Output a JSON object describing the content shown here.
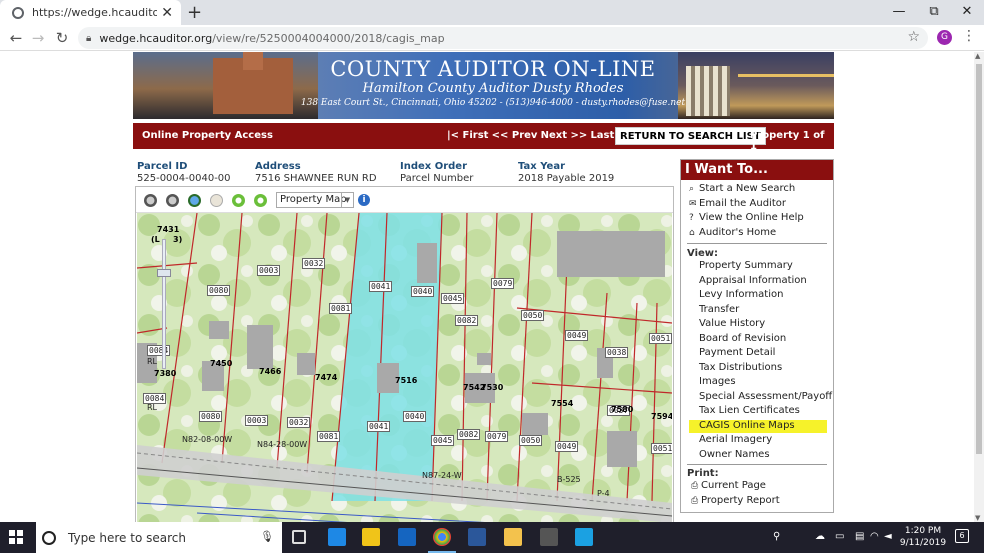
{
  "browser": {
    "tab_title": "https://wedge.hcauditor.org/vie",
    "close_glyph": "✕",
    "new_tab_glyph": "+",
    "window_controls": [
      "—",
      "⧉",
      "✕"
    ],
    "url_host": "wedge.hcauditor.org",
    "url_path": "/view/re/5250004004000/2018/cagis_map",
    "profile_initial": "G"
  },
  "banner": {
    "title": "COUNTY AUDITOR ON-LINE",
    "subtitle": "Hamilton County Auditor Dusty Rhodes",
    "address": "138 East Court St., Cincinnati, Ohio 45202 - (513)946-4000 - dusty.rhodes@fuse.net"
  },
  "redbar": {
    "section": "Online Property Access",
    "first": "|< First",
    "prev": "<< Prev",
    "next": "Next >>",
    "last": "Last >|",
    "return_button": "RETURN TO SEARCH LIST",
    "property_of": "Property 1 of 1"
  },
  "parcel": {
    "id_label": "Parcel ID",
    "id_value": "525-0004-0040-00",
    "address_label": "Address",
    "address_value": "7516 SHAWNEE RUN RD",
    "index_label": "Index Order",
    "index_value": "Parcel Number",
    "year_label": "Tax Year",
    "year_value": "2018 Payable 2019"
  },
  "map": {
    "selected_layer": "Property Map",
    "info_glyph": "i",
    "zoom_values": [
      "7431",
      "(L",
      "3)"
    ],
    "parcel_numbers": [
      "0032",
      "0003",
      "0080",
      "0081",
      "0041",
      "0040",
      "0045",
      "0079",
      "0082",
      "0050",
      "0049",
      "0051",
      "0038",
      "0084",
      "0041",
      "0040",
      "0045",
      "0082",
      "0079",
      "0050",
      "0049",
      "0051",
      "0081",
      "0032",
      "0003",
      "0080",
      "0084",
      "0037"
    ],
    "house_numbers": [
      "7450",
      "7466",
      "7474",
      "7516",
      "7542",
      "7530",
      "7554",
      "7580",
      "7594",
      "7380"
    ],
    "road_labels": [
      "N82-08-00W",
      "N84-28-00W",
      "N87-24-W",
      "B-525",
      "P-4",
      "RL",
      "RL"
    ]
  },
  "iwant": {
    "title": "I Want To...",
    "actions": [
      {
        "icon": "⌕",
        "label": "Start a New Search"
      },
      {
        "icon": "✉",
        "label": "Email the Auditor"
      },
      {
        "icon": "?",
        "label": "View the Online Help"
      },
      {
        "icon": "⌂",
        "label": "Auditor's Home"
      }
    ],
    "view_label": "View:",
    "view_items": [
      "Property Summary",
      "Appraisal Information",
      "Levy Information",
      "Transfer",
      "Value History",
      "Board of Revision",
      "Payment Detail",
      "Tax Distributions",
      "Images",
      "Special Assessment/Payoff",
      "Tax Lien Certificates",
      "CAGIS Online Maps",
      "Aerial Imagery",
      "Owner Names"
    ],
    "print_label": "Print:",
    "print_items": [
      "Current Page",
      "Property Report"
    ],
    "highlight_color": "#f6f22a"
  },
  "taskbar": {
    "search_placeholder": "Type here to search",
    "time": "1:20 PM",
    "date": "9/11/2019",
    "notification_count": "6"
  },
  "colors": {
    "brand_red": "#8a0f0f",
    "label_blue": "#1f4e79",
    "highlight_parcel": "#7fe0e6"
  }
}
